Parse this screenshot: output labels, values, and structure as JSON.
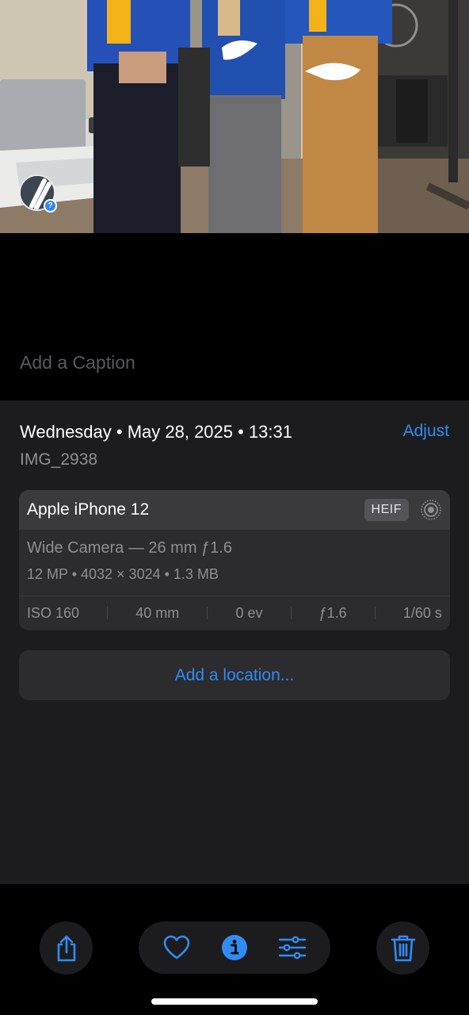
{
  "caption": {
    "placeholder": "Add a Caption"
  },
  "meta": {
    "date_line": "Wednesday • May 28, 2025 • 13:31",
    "adjust_label": "Adjust",
    "filename": "IMG_2938"
  },
  "camera": {
    "model": "Apple iPhone 12",
    "format": "HEIF",
    "lens": "Wide Camera — 26 mm ƒ1.6",
    "specs": "12 MP • 4032 × 3024 • 1.3 MB",
    "exif": {
      "iso": "ISO 160",
      "focal": "40 mm",
      "ev": "0 ev",
      "aperture": "ƒ1.6",
      "shutter": "1/60 s"
    }
  },
  "location": {
    "label": "Add a location..."
  },
  "toolbar": {
    "icons": [
      "share-icon",
      "heart-icon",
      "info-icon",
      "adjust-sliders-icon",
      "trash-icon"
    ]
  },
  "colors": {
    "accent": "#2f8cf4",
    "panel": "#1c1c1e",
    "card": "#2c2c2e",
    "secondary_text": "#8e8e93"
  }
}
